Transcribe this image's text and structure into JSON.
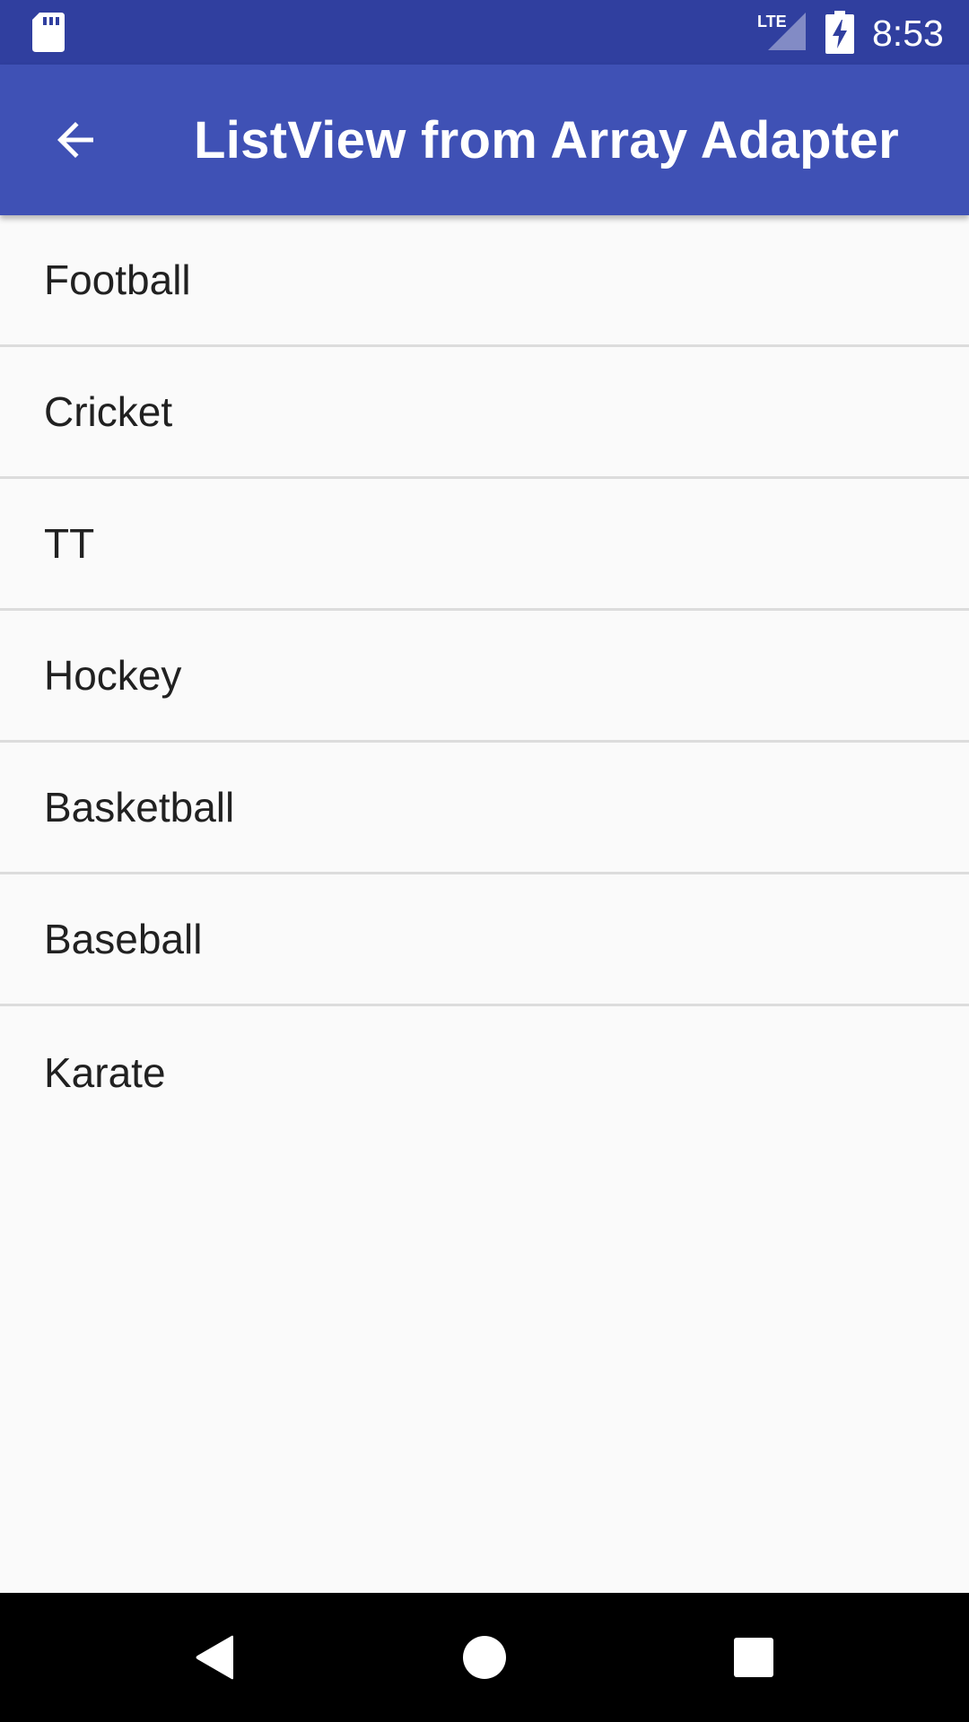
{
  "status_bar": {
    "time": "8:53",
    "network": "LTE",
    "icons": [
      "sd-card-icon",
      "lte-signal-icon",
      "battery-charging-icon"
    ]
  },
  "app_bar": {
    "title": "ListView from Array Adapter",
    "back_icon": "arrow-back-icon",
    "background": "#3f51b5",
    "status_background": "#303f9f"
  },
  "list": {
    "items": [
      {
        "label": "Football"
      },
      {
        "label": "Cricket"
      },
      {
        "label": "TT"
      },
      {
        "label": "Hockey"
      },
      {
        "label": "Basketball"
      },
      {
        "label": "Baseball"
      },
      {
        "label": "Karate"
      }
    ]
  },
  "nav_bar": {
    "buttons": [
      "back-triangle-icon",
      "home-circle-icon",
      "recents-square-icon"
    ]
  }
}
